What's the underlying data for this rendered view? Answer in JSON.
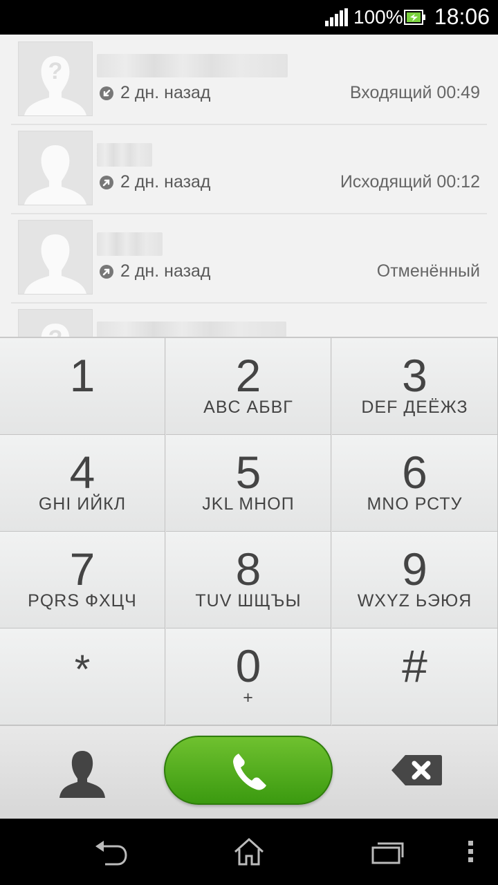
{
  "status_bar": {
    "battery": "100%",
    "time": "18:06"
  },
  "call_log": [
    {
      "when": "2 дн. назад",
      "type": "Входящий 00:49",
      "direction": "incoming",
      "avatar": "unknown-contact-icon",
      "blur_width": 276
    },
    {
      "when": "2 дн. назад",
      "type": "Исходящий 00:12",
      "direction": "outgoing",
      "avatar": "contact-silhouette-icon",
      "blur_width": 80
    },
    {
      "when": "2 дн. назад",
      "type": "Отменённый",
      "direction": "outgoing",
      "avatar": "contact-silhouette-icon",
      "blur_width": 95
    },
    {
      "when": "",
      "type": "",
      "direction": "",
      "avatar": "unknown-contact-icon",
      "blur_width": 274
    }
  ],
  "keypad": [
    {
      "digit": "1",
      "letters": ""
    },
    {
      "digit": "2",
      "letters": "ABC АБВГ"
    },
    {
      "digit": "3",
      "letters": "DEF ДЕЁЖЗ"
    },
    {
      "digit": "4",
      "letters": "GHI ИЙКЛ"
    },
    {
      "digit": "5",
      "letters": "JKL МНОП"
    },
    {
      "digit": "6",
      "letters": "MNO РСТУ"
    },
    {
      "digit": "7",
      "letters": "PQRS ФХЦЧ"
    },
    {
      "digit": "8",
      "letters": "TUV ШЩЪЫ"
    },
    {
      "digit": "9",
      "letters": "WXYZ ЬЭЮЯ"
    },
    {
      "digit": "*",
      "letters": ""
    },
    {
      "digit": "0",
      "letters": "+"
    },
    {
      "digit": "#",
      "letters": ""
    }
  ],
  "colors": {
    "call_button": "#4caf1a",
    "status_bar": "#000000",
    "nav_bar": "#000000"
  },
  "icons": {
    "contacts": "person-icon",
    "call": "phone-icon",
    "backspace": "backspace-icon",
    "nav": [
      "back-icon",
      "home-icon",
      "recent-apps-icon",
      "overflow-menu-icon"
    ]
  }
}
